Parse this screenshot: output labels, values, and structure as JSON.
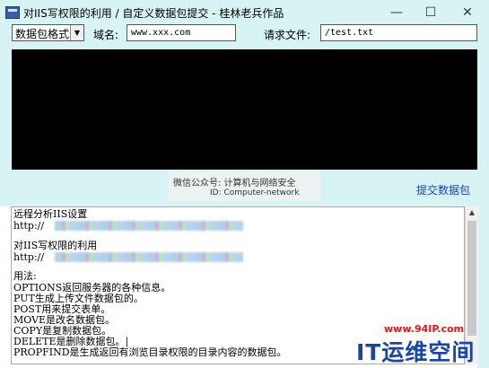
{
  "window": {
    "title": "对IIS写权限的利用 / 自定义数据包提交 - 桂林老兵作品",
    "min_glyph": "—",
    "max_glyph": "☐",
    "close_glyph": "✕"
  },
  "toolbar": {
    "packet_format": "数据包格式",
    "domain_label": "域名:",
    "domain_value": "www.xxx.com",
    "request_file_label": "请求文件:",
    "request_file_value": "/test.txt"
  },
  "watermark": {
    "line1": "微信公众号: 计算机与网络安全",
    "line2": "ID: Computer-network"
  },
  "submit_label": "提交数据包",
  "output_lines": [
    "远程分析IIS设置",
    "http://",
    "",
    "对IIS写权限的利用",
    "http://",
    "",
    "用法:",
    "OPTIONS返回服务器的各种信息。",
    "PUT生成上传文件数据包的。",
    "POST用来提交表单。",
    "MOVE是改名数据包。",
    "COPY是复制数据包。",
    "DELETE是删除数据包。|",
    "PROPFIND是生成返回有浏览目录权限的目录内容的数据包。"
  ],
  "corner": {
    "site": "www.94IP.com",
    "brand": "IT运维空间"
  },
  "colors": {
    "background": "#d8f3f3",
    "link": "#1a3fc7",
    "brand_blue": "#1846a8",
    "site_red": "#e01818"
  }
}
